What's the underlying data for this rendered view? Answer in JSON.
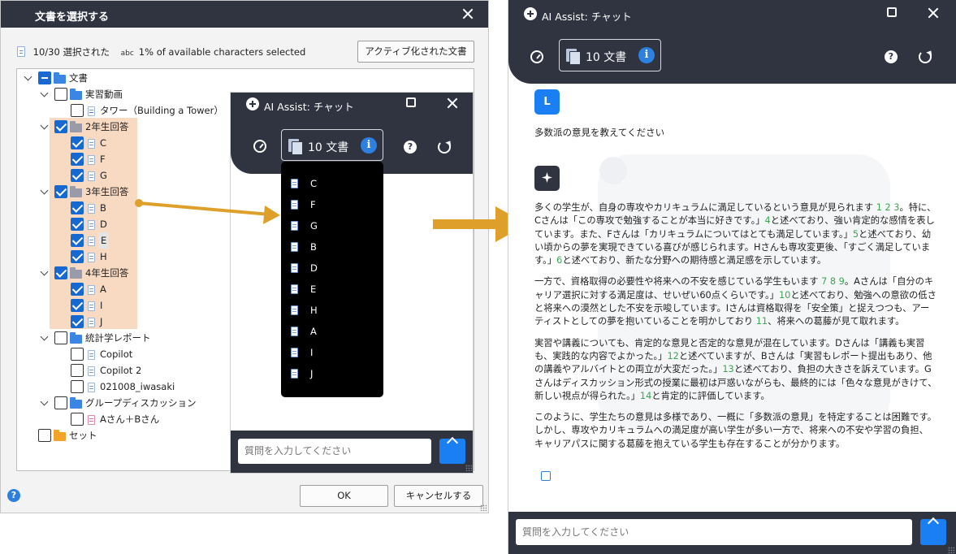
{
  "dialog": {
    "title": "文書を選択する",
    "selected_count": "10/30 選択された",
    "abc_icon": "abc",
    "chars_selected": "1% of available characters selected",
    "activated_button": "アクティブ化された文書",
    "ok_button": "OK",
    "cancel_button": "キャンセルする",
    "help_icon": "?",
    "tree": {
      "root": "文書",
      "folders": [
        {
          "name": "実習動画",
          "items": [
            "タワー（Building a Tower）"
          ]
        },
        {
          "name": "2年生回答",
          "items": [
            "C",
            "F",
            "G"
          ]
        },
        {
          "name": "3年生回答",
          "items": [
            "B",
            "D",
            "E",
            "H"
          ]
        },
        {
          "name": "4年生回答",
          "items": [
            "A",
            "I",
            "J"
          ]
        },
        {
          "name": "統計学レポート",
          "items": [
            "Copilot",
            "Copilot 2",
            "021008_iwasaki"
          ]
        },
        {
          "name": "グループディスカッション",
          "items": [
            "Aさん＋Bさん"
          ]
        },
        {
          "name": "セット",
          "items": []
        }
      ]
    }
  },
  "chat_small": {
    "title": "AI Assist: チャット",
    "docs_label": "10 文書",
    "info_icon": "i",
    "help_icon": "?",
    "dropdown": [
      "C",
      "F",
      "G",
      "B",
      "D",
      "E",
      "H",
      "A",
      "I",
      "J"
    ],
    "input_placeholder": "質問を入力してください"
  },
  "chat_big": {
    "title": "AI Assist: チャット",
    "docs_label": "10 文書",
    "info_icon": "i",
    "help_icon": "?",
    "user_initial": "L",
    "user_message": "多数派の意見を教えてください",
    "input_placeholder": "質問を入力してください",
    "answer": [
      [
        {
          "t": "多くの学生が、自身の専攻やカリキュラムに満足しているという意見が見られます "
        },
        {
          "t": "1 2 3",
          "c": 1
        },
        {
          "t": "。特に、Cさんは「この専攻で勉強することが本当に好きです。」"
        },
        {
          "t": "4",
          "c": 1
        },
        {
          "t": "と述べており、強い肯定的な感情を表しています。また、Fさんは「カリキュラムについてはとても満足しています。」"
        },
        {
          "t": "5",
          "c": 1
        },
        {
          "t": "と述べており、幼い頃からの夢を実現できている喜びが感じられます。Hさんも専攻変更後、「すごく満足しています。」"
        },
        {
          "t": "6",
          "c": 1
        },
        {
          "t": "と述べており、新たな分野への期待感と満足感を示しています。"
        }
      ],
      [
        {
          "t": "一方で、資格取得の必要性や将来への不安を感じている学生もいます "
        },
        {
          "t": "7 8 9",
          "c": 1
        },
        {
          "t": "。Aさんは「自分のキャリア選択に対する満足度は、せいぜい60点くらいです。」"
        },
        {
          "t": "10",
          "c": 1
        },
        {
          "t": "と述べており、勉強への意欲の低さと将来への漠然とした不安を示唆しています。Iさんは資格取得を「安全策」と捉えつつも、アーティストとしての夢を抱いていることを明かしており "
        },
        {
          "t": "11",
          "c": 1
        },
        {
          "t": "、将来への葛藤が見て取れます。"
        }
      ],
      [
        {
          "t": "実習や講義についても、肯定的な意見と否定的な意見が混在しています。Dさんは「講義も実習も、実践的な内容でよかった。」"
        },
        {
          "t": "12",
          "c": 1
        },
        {
          "t": "と述べていますが、Bさんは「実習もレポート提出もあり、他の講義やアルバイトとの両立が大変だった。」"
        },
        {
          "t": "13",
          "c": 1
        },
        {
          "t": "と述べており、負担の大きさを訴えています。Gさんはディスカッション形式の授業に最初は戸惑いながらも、最終的には「色々な意見がきけて、新しい視点が得られた。」"
        },
        {
          "t": "14",
          "c": 1
        },
        {
          "t": "と肯定的に評価しています。"
        }
      ],
      [
        {
          "t": "このように、学生たちの意見は多様であり、一概に「多数派の意見」を特定することは困難です。しかし、専攻やカリキュラムへの満足度が高い学生が多い一方で、将来への不安や学習の負担、キャリアパスに関する葛藤を抱えている学生も存在することが分かります。"
        }
      ]
    ]
  },
  "colors": {
    "header": "#2f3440",
    "accent": "#1a7ff2",
    "highlight": "#f8d9c2",
    "arrow": "#dea02b",
    "citation": "#3aa651"
  }
}
